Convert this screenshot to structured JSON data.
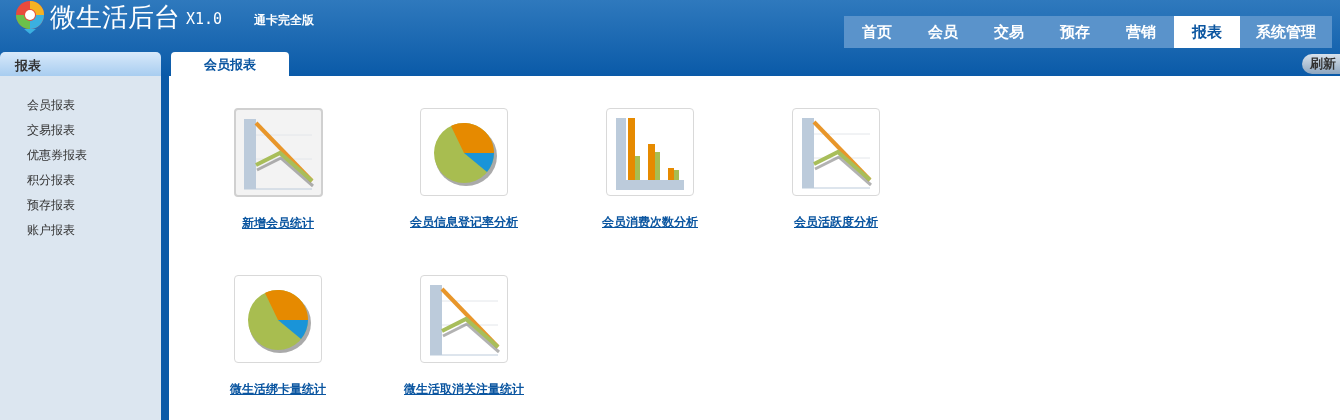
{
  "header": {
    "app_name": "微生活后台",
    "version": "X1.0",
    "edition": "通卡完全版"
  },
  "nav": [
    {
      "label": "首页",
      "selected": false
    },
    {
      "label": "会员",
      "selected": false
    },
    {
      "label": "交易",
      "selected": false
    },
    {
      "label": "预存",
      "selected": false
    },
    {
      "label": "营销",
      "selected": false
    },
    {
      "label": "报表",
      "selected": true
    },
    {
      "label": "系统管理",
      "selected": false
    }
  ],
  "sidebar": {
    "title": "报表",
    "items": [
      "会员报表",
      "交易报表",
      "优惠券报表",
      "积分报表",
      "预存报表",
      "账户报表"
    ]
  },
  "tabs": [
    {
      "label": "会员报表",
      "selected": true
    }
  ],
  "refresh_button": "刷新",
  "reports": [
    {
      "label": "新增会员统计",
      "kind": "line",
      "selected": true
    },
    {
      "label": "会员信息登记率分析",
      "kind": "pie",
      "selected": false
    },
    {
      "label": "会员消费次数分析",
      "kind": "bar",
      "selected": false
    },
    {
      "label": "会员活跃度分析",
      "kind": "line",
      "selected": false
    },
    {
      "label": "微生活绑卡量统计",
      "kind": "pie",
      "selected": false
    },
    {
      "label": "微生活取消关注量统计",
      "kind": "line",
      "selected": false
    }
  ]
}
